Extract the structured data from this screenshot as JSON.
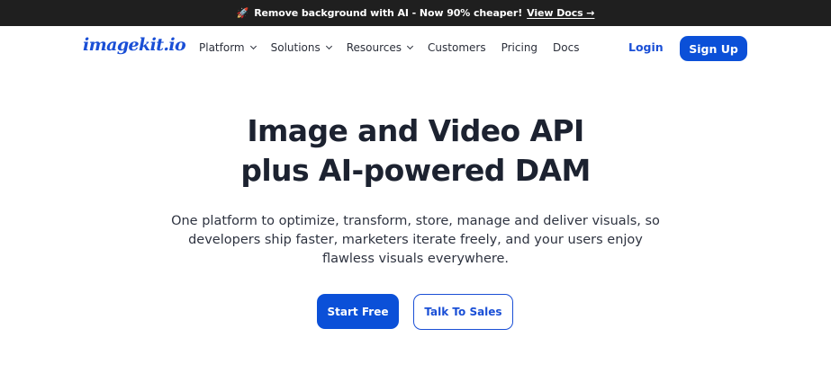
{
  "announcement": {
    "icon": "rocket-icon",
    "text": "Remove background with AI - Now 90% cheaper!",
    "link_label": "View Docs →"
  },
  "nav": {
    "logo_text": "imagekit.io",
    "items": [
      {
        "label": "Platform",
        "has_dropdown": true
      },
      {
        "label": "Solutions",
        "has_dropdown": true
      },
      {
        "label": "Resources",
        "has_dropdown": true
      },
      {
        "label": "Customers",
        "has_dropdown": false
      },
      {
        "label": "Pricing",
        "has_dropdown": false
      },
      {
        "label": "Docs",
        "has_dropdown": false
      }
    ],
    "login_label": "Login",
    "signup_label": "Sign Up"
  },
  "hero": {
    "title_line1": "Image and Video API",
    "title_line2": "plus AI-powered DAM",
    "subtitle": "One platform to optimize, transform, store, manage and deliver visuals, so developers ship faster, marketers iterate freely, and your users enjoy flawless visuals everywhere.",
    "primary_cta": "Start Free",
    "secondary_cta": "Talk To Sales"
  },
  "colors": {
    "brand_blue": "#0b50d8",
    "topbar_bg": "#1f1f1f",
    "text_dark": "#1c2230"
  }
}
